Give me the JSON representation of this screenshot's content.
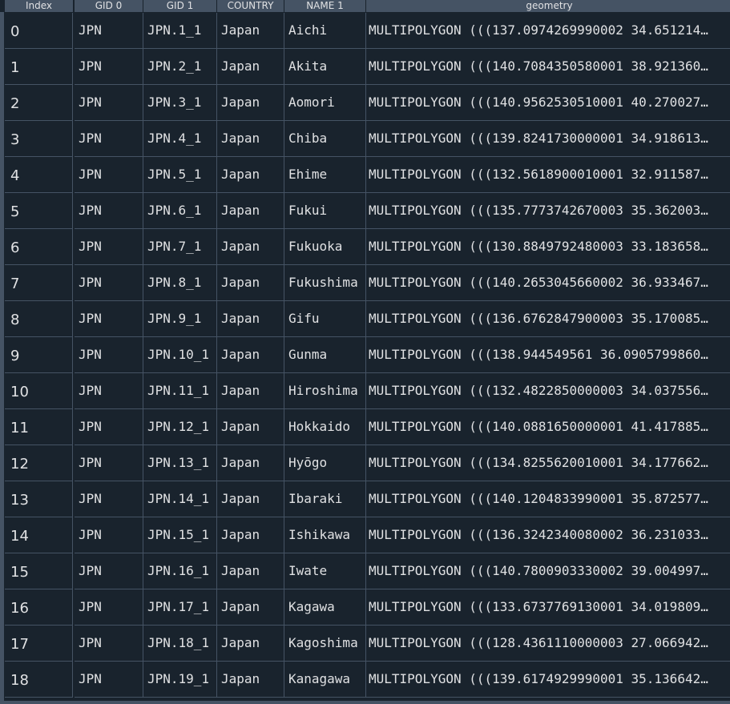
{
  "table": {
    "index_header": "Index",
    "columns": [
      "GID 0",
      "GID 1",
      "COUNTRY",
      "NAME 1",
      "geometry"
    ],
    "rows": [
      {
        "index": "0",
        "gid0": "JPN",
        "gid1": "JPN.1_1",
        "country": "Japan",
        "name1": "Aichi",
        "geometry": "MULTIPOLYGON (((137.0974269990002 34.651214…"
      },
      {
        "index": "1",
        "gid0": "JPN",
        "gid1": "JPN.2_1",
        "country": "Japan",
        "name1": "Akita",
        "geometry": "MULTIPOLYGON (((140.7084350580001 38.921360…"
      },
      {
        "index": "2",
        "gid0": "JPN",
        "gid1": "JPN.3_1",
        "country": "Japan",
        "name1": "Aomori",
        "geometry": "MULTIPOLYGON (((140.9562530510001 40.270027…"
      },
      {
        "index": "3",
        "gid0": "JPN",
        "gid1": "JPN.4_1",
        "country": "Japan",
        "name1": "Chiba",
        "geometry": "MULTIPOLYGON (((139.8241730000001 34.918613…"
      },
      {
        "index": "4",
        "gid0": "JPN",
        "gid1": "JPN.5_1",
        "country": "Japan",
        "name1": "Ehime",
        "geometry": "MULTIPOLYGON (((132.5618900010001 32.911587…"
      },
      {
        "index": "5",
        "gid0": "JPN",
        "gid1": "JPN.6_1",
        "country": "Japan",
        "name1": "Fukui",
        "geometry": "MULTIPOLYGON (((135.7773742670003 35.362003…"
      },
      {
        "index": "6",
        "gid0": "JPN",
        "gid1": "JPN.7_1",
        "country": "Japan",
        "name1": "Fukuoka",
        "geometry": "MULTIPOLYGON (((130.8849792480003 33.183658…"
      },
      {
        "index": "7",
        "gid0": "JPN",
        "gid1": "JPN.8_1",
        "country": "Japan",
        "name1": "Fukushima",
        "geometry": "MULTIPOLYGON (((140.2653045660002 36.933467…"
      },
      {
        "index": "8",
        "gid0": "JPN",
        "gid1": "JPN.9_1",
        "country": "Japan",
        "name1": "Gifu",
        "geometry": "MULTIPOLYGON (((136.6762847900003 35.170085…"
      },
      {
        "index": "9",
        "gid0": "JPN",
        "gid1": "JPN.10_1",
        "country": "Japan",
        "name1": "Gunma",
        "geometry": "MULTIPOLYGON (((138.944549561 36.0905799860…"
      },
      {
        "index": "10",
        "gid0": "JPN",
        "gid1": "JPN.11_1",
        "country": "Japan",
        "name1": "Hiroshima",
        "geometry": "MULTIPOLYGON (((132.4822850000003 34.037556…"
      },
      {
        "index": "11",
        "gid0": "JPN",
        "gid1": "JPN.12_1",
        "country": "Japan",
        "name1": "Hokkaido",
        "geometry": "MULTIPOLYGON (((140.0881650000001 41.417885…"
      },
      {
        "index": "12",
        "gid0": "JPN",
        "gid1": "JPN.13_1",
        "country": "Japan",
        "name1": "Hyōgo",
        "geometry": "MULTIPOLYGON (((134.8255620010001 34.177662…"
      },
      {
        "index": "13",
        "gid0": "JPN",
        "gid1": "JPN.14_1",
        "country": "Japan",
        "name1": "Ibaraki",
        "geometry": "MULTIPOLYGON (((140.1204833990001 35.872577…"
      },
      {
        "index": "14",
        "gid0": "JPN",
        "gid1": "JPN.15_1",
        "country": "Japan",
        "name1": "Ishikawa",
        "geometry": "MULTIPOLYGON (((136.3242340080002 36.231033…"
      },
      {
        "index": "15",
        "gid0": "JPN",
        "gid1": "JPN.16_1",
        "country": "Japan",
        "name1": "Iwate",
        "geometry": "MULTIPOLYGON (((140.7800903330002 39.004997…"
      },
      {
        "index": "16",
        "gid0": "JPN",
        "gid1": "JPN.17_1",
        "country": "Japan",
        "name1": "Kagawa",
        "geometry": "MULTIPOLYGON (((133.6737769130001 34.019809…"
      },
      {
        "index": "17",
        "gid0": "JPN",
        "gid1": "JPN.18_1",
        "country": "Japan",
        "name1": "Kagoshima",
        "geometry": "MULTIPOLYGON (((128.4361110000003 27.066942…"
      },
      {
        "index": "18",
        "gid0": "JPN",
        "gid1": "JPN.19_1",
        "country": "Japan",
        "name1": "Kanagawa",
        "geometry": "MULTIPOLYGON (((139.6174929990001 35.136642…"
      }
    ]
  },
  "colors": {
    "background": "#19232d",
    "header_bg": "#455364",
    "grid_line": "#455364",
    "text": "#e0e1e3"
  }
}
